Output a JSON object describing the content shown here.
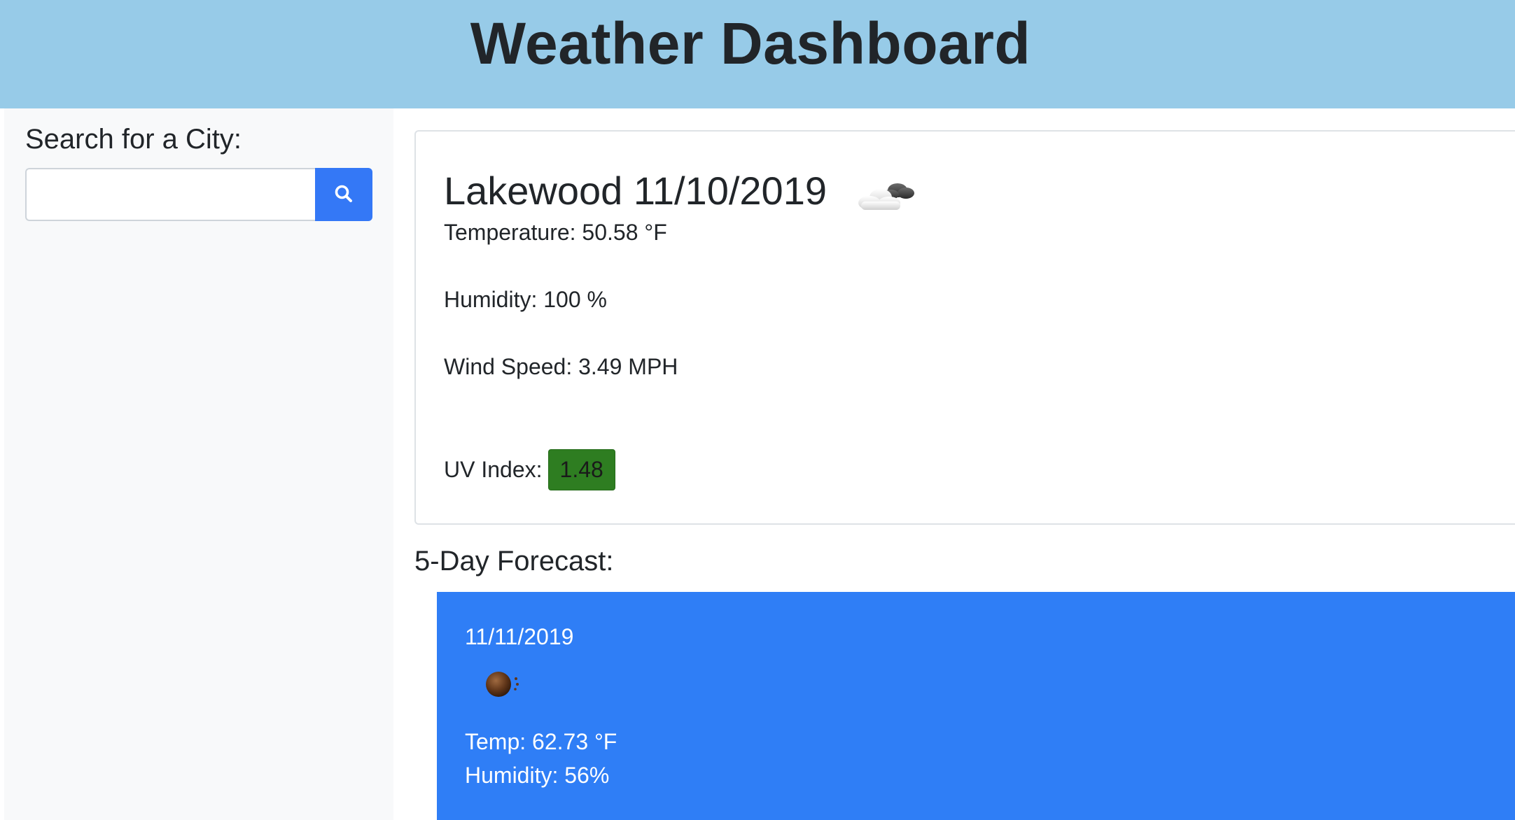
{
  "header": {
    "title": "Weather Dashboard"
  },
  "sidebar": {
    "label": "Search for a City:",
    "search_value": "",
    "search_icon": "search-icon"
  },
  "current": {
    "city_date": "Lakewood 11/10/2019",
    "icon": "cloud-icon",
    "temperature": "Temperature: 50.58 °F",
    "humidity": "Humidity: 100 %",
    "wind_speed": "Wind Speed: 3.49 MPH",
    "uv_label": "UV Index:",
    "uv_value": "1.48",
    "uv_color": "#2e7d21"
  },
  "forecast": {
    "heading": "5-Day Forecast:",
    "card_color": "#2f7ef6",
    "days": [
      {
        "date": "11/11/2019",
        "icon": "sun-icon",
        "temp": "Temp: 62.73 °F",
        "humidity": "Humidity: 56%"
      }
    ]
  },
  "colors": {
    "header_bg": "#97cbe8",
    "sidebar_bg": "#f8f9fa",
    "accent": "#3478f6"
  }
}
